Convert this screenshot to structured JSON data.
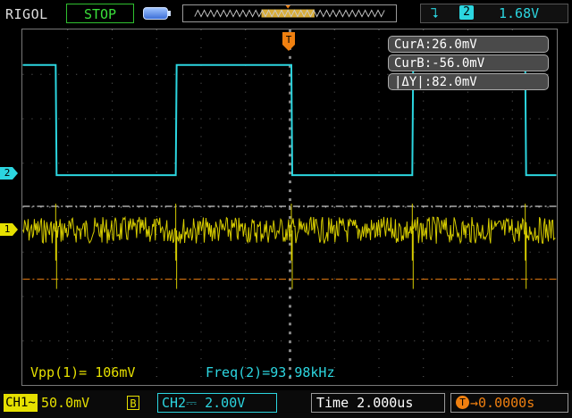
{
  "header": {
    "brand": "RIGOL",
    "run_state": "STOP",
    "trigger_channel": "2",
    "trigger_level": "1.68V"
  },
  "cursors": {
    "cur_a": "CurA:26.0mV",
    "cur_b": "CurB:-56.0mV",
    "delta_y": "|ΔY|:82.0mV"
  },
  "measurements": {
    "vpp": "Vpp(1)= 106mV",
    "freq": "Freq(2)=93.98kHz"
  },
  "markers": {
    "ch2": "2",
    "ch1": "1",
    "trigger": "T"
  },
  "footer": {
    "ch1_label": "CH1",
    "ch1_coupling": "~",
    "ch1_scale": "50.0mV",
    "ch1_bw": "B",
    "ch2_label": "CH2",
    "ch2_coupling": "⎓",
    "ch2_scale": "2.00V",
    "time_label": "Time",
    "time_scale": "2.000us",
    "trigger_offset": "→0.0000s"
  },
  "colors": {
    "ch1": "#e6e000",
    "ch2": "#2cd6e0",
    "trigger": "#f08010",
    "run_state": "#3adf3a"
  }
}
